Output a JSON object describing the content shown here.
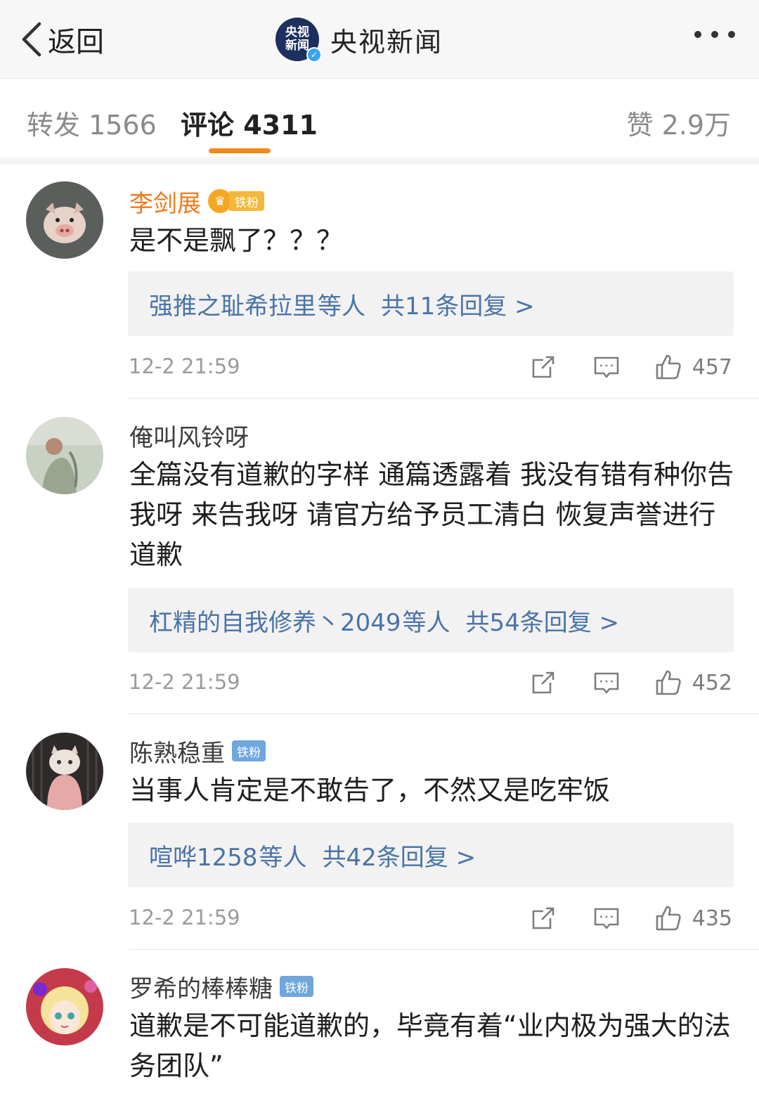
{
  "nav": {
    "back_label": "返回",
    "logo_text": "央视新闻",
    "title": "央视新闻"
  },
  "tabs": {
    "repost": "转发 1566",
    "comments": "评论 4311",
    "likes": "赞 2.9万"
  },
  "colors": {
    "accent": "#f28a1a",
    "link": "#4a74a8",
    "vip_name": "#f07a1c",
    "fan_badge": "#6fa6dc"
  },
  "comments": [
    {
      "username": "李剑展",
      "badge": "铁粉",
      "text": "是不是飘了？？？",
      "reply_users": "强推之耻希拉里",
      "reply_suffix": "等人",
      "reply_count": "共11条回复 >",
      "time": "12-2 21:59",
      "likes": "457"
    },
    {
      "username": "俺叫风铃呀",
      "text": "全篇没有道歉的字样 通篇透露着 我没有错有种你告我呀 来告我呀 请官方给予员工清白 恢复声誉进行道歉",
      "reply_users": "杠精的自我修养丶2049",
      "reply_suffix": "等人",
      "reply_count": "共54条回复 >",
      "time": "12-2 21:59",
      "likes": "452"
    },
    {
      "username": "陈熟稳重",
      "badge": "铁粉",
      "text": "当事人肯定是不敢告了，不然又是吃牢饭",
      "reply_users": "喧哗1258",
      "reply_suffix": "等人",
      "reply_count": "共42条回复 >",
      "time": "12-2 21:59",
      "likes": "435"
    },
    {
      "username": "罗希的棒棒糖",
      "badge": "铁粉",
      "text": "道歉是不可能道歉的，毕竟有着“业内极为强大的法务团队”"
    }
  ]
}
